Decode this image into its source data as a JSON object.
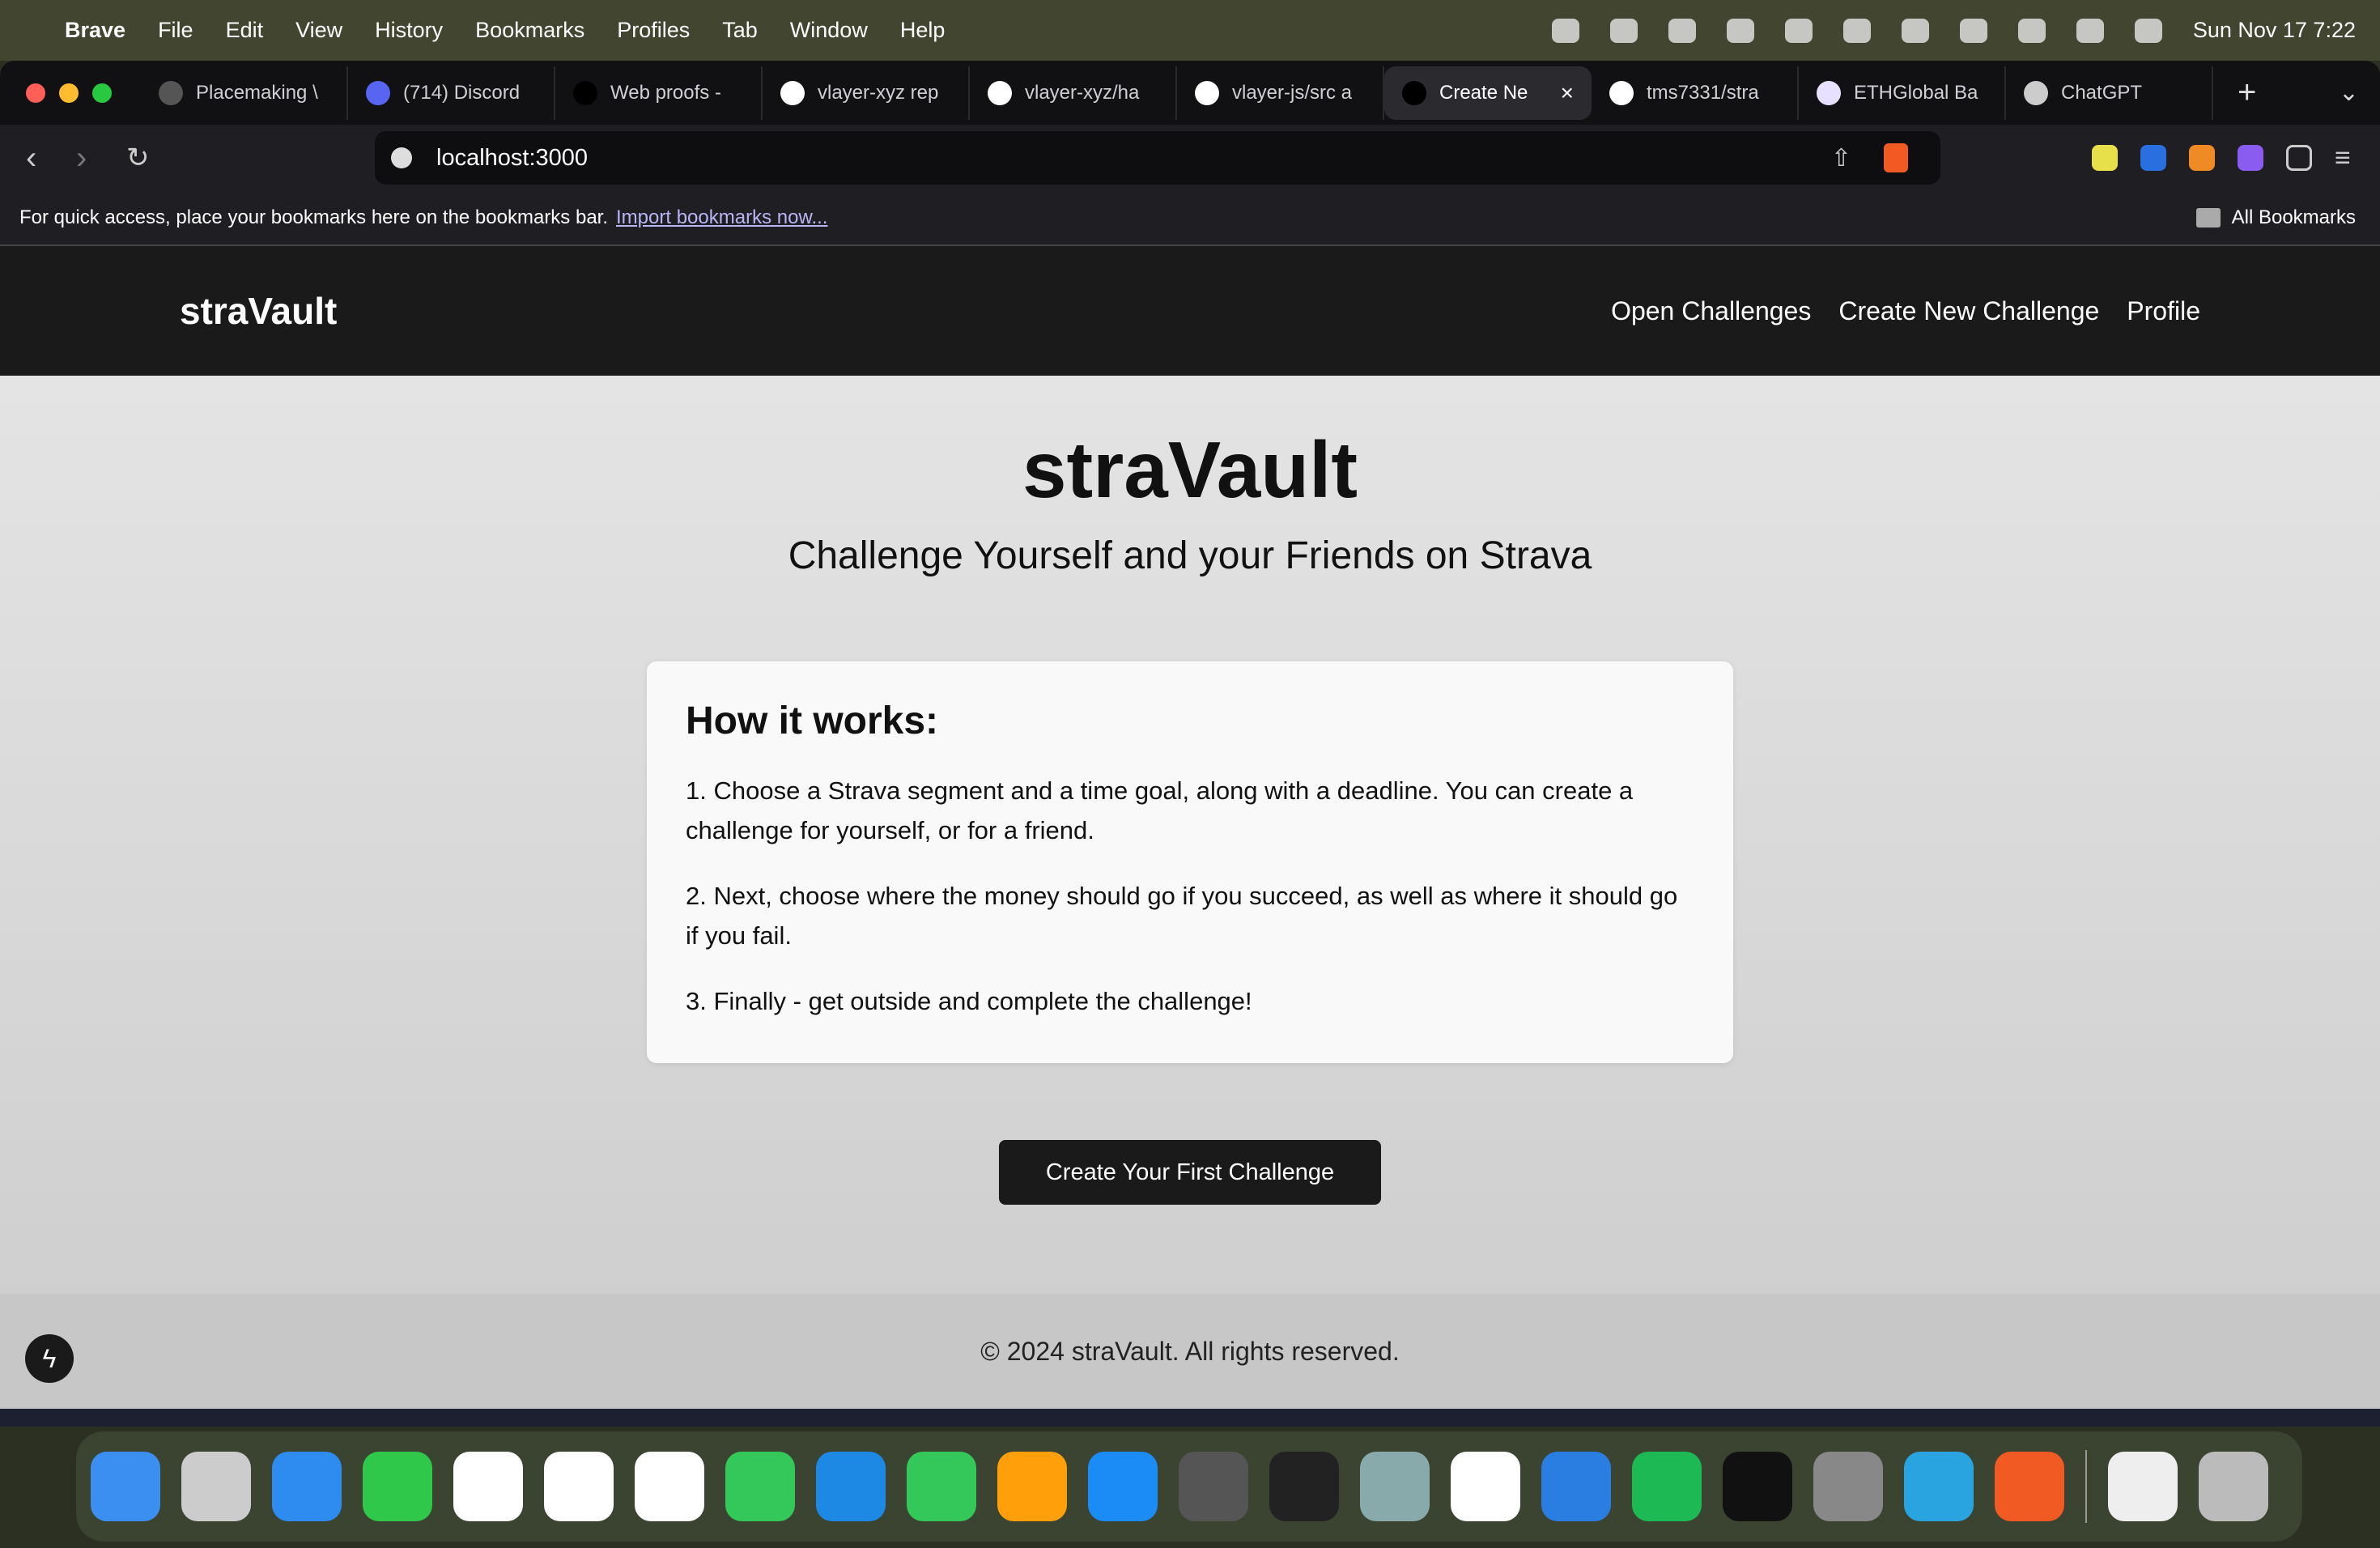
{
  "menubar": {
    "app": "Brave",
    "items": [
      "File",
      "Edit",
      "View",
      "History",
      "Bookmarks",
      "Profiles",
      "Tab",
      "Window",
      "Help"
    ],
    "datetime": "Sun Nov 17  7:22"
  },
  "tabs": [
    {
      "label": "Placemaking \\",
      "fav": "#555"
    },
    {
      "label": "(714) Discord",
      "fav": "#5865f2"
    },
    {
      "label": "Web proofs -",
      "fav": "#000"
    },
    {
      "label": "vlayer-xyz rep",
      "fav": "#fff"
    },
    {
      "label": "vlayer-xyz/ha",
      "fav": "#fff"
    },
    {
      "label": "vlayer-js/src a",
      "fav": "#fff"
    },
    {
      "label": "Create Ne",
      "fav": "#000",
      "active": true
    },
    {
      "label": "tms7331/stra",
      "fav": "#fff"
    },
    {
      "label": "ETHGlobal Ba",
      "fav": "#e8e0ff"
    },
    {
      "label": "ChatGPT",
      "fav": "#ccc"
    }
  ],
  "toolbar": {
    "url": "localhost:3000"
  },
  "bookmarks": {
    "hint": "For quick access, place your bookmarks here on the bookmarks bar.",
    "import_link": "Import bookmarks now...",
    "all": "All Bookmarks"
  },
  "site": {
    "brand": "straVault",
    "links": [
      "Open Challenges",
      "Create New Challenge",
      "Profile"
    ]
  },
  "hero": {
    "title": "straVault",
    "subtitle": "Challenge Yourself and your Friends on Strava"
  },
  "card": {
    "heading": "How it works:",
    "steps": [
      "1. Choose a Strava segment and a time goal, along with a deadline. You can create a challenge for yourself, or for a friend.",
      "2. Next, choose where the money should go if you succeed, as well as where it should go if you fail.",
      "3. Finally - get outside and complete the challenge!"
    ]
  },
  "cta": "Create Your First Challenge",
  "footer": "© 2024 straVault. All rights reserved.",
  "dock": [
    "finder",
    "launchpad",
    "mail",
    "facetime",
    "calendar",
    "reminders",
    "freeform",
    "messages",
    "keynote",
    "numbers",
    "pages",
    "app-store",
    "iphone-mirroring",
    "terminal",
    "preview",
    "slack",
    "vpn",
    "spotify",
    "cursor",
    "system-settings",
    "telegram",
    "brave",
    "document",
    "trash"
  ],
  "dock_colors": [
    "#3b8ff0",
    "#ccc",
    "#2e8cf0",
    "#2fc84a",
    "#fff",
    "#fff",
    "#fff",
    "#34c759",
    "#1e88e5",
    "#34c759",
    "#ff9f0a",
    "#1b8cf5",
    "#555",
    "#222",
    "#8aa",
    "#fff",
    "#2a7de1",
    "#1db954",
    "#111",
    "#888",
    "#2aa4e0",
    "#f15b23",
    "#eee",
    "#bbb"
  ]
}
